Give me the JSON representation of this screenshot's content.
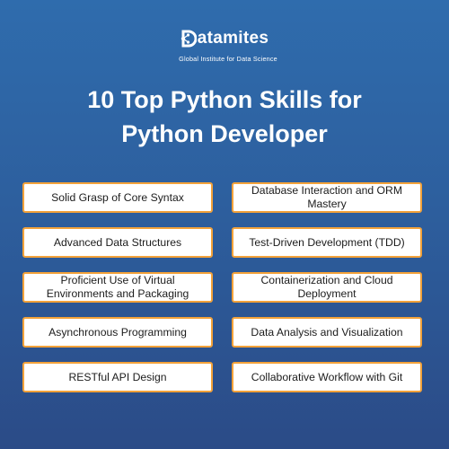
{
  "brand": {
    "name": "Datamites",
    "name_rest": "atamites",
    "tagline": "Global Institute for Data Science"
  },
  "title": {
    "line1": "10 Top Python Skills for",
    "line2": "Python Developer"
  },
  "skills_left": [
    "Solid Grasp of Core Syntax",
    "Advanced Data Structures",
    "Proficient Use of Virtual Environments and Packaging",
    "Asynchronous Programming",
    "RESTful API Design"
  ],
  "skills_right": [
    "Database Interaction and ORM Mastery",
    "Test-Driven Development (TDD)",
    "Containerization and Cloud Deployment",
    "Data Analysis and Visualization",
    "Collaborative Workflow with Git"
  ],
  "colors": {
    "background_top": "#2f6cad",
    "background_bottom": "#2b4b87",
    "card_border": "#f3a23a",
    "card_fill": "#ffffff",
    "text_light": "#ffffff"
  }
}
